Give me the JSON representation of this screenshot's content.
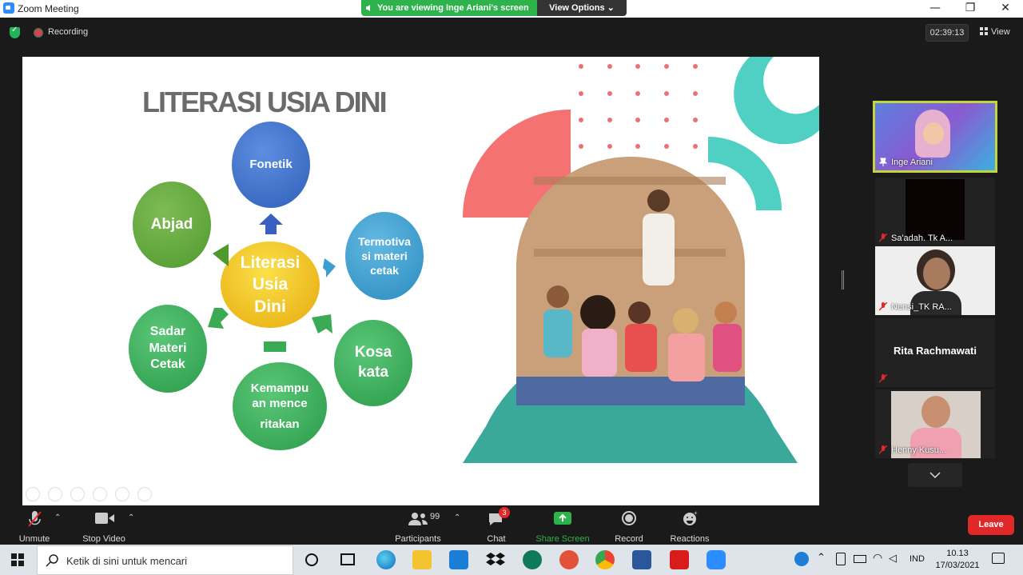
{
  "window": {
    "title": "Zoom Meeting",
    "minimize": "—",
    "maximize": "❐",
    "close": "✕"
  },
  "share_banner": {
    "viewing_text": "You are viewing Inge Ariani's screen",
    "view_options_label": "View Options ⌄"
  },
  "top_bar": {
    "recording_label": "Recording",
    "timer": "02:39:13",
    "view_label": "View"
  },
  "slide": {
    "title": "LITERASI USIA DINI",
    "center_bubble": [
      "Literasi",
      "Usia",
      "Dini"
    ],
    "bubbles": {
      "fonetik": "Fonetik",
      "termotivasi": [
        "Termotiva",
        "si materi",
        "cetak"
      ],
      "kosa_kata": [
        "Kosa",
        "kata"
      ],
      "kemampuan": [
        "Kemampu",
        "an mence",
        "ritakan"
      ],
      "sadar": [
        "Sadar",
        "Materi",
        "Cetak"
      ],
      "abjad": "Abjad"
    },
    "colors": {
      "blue": "#3a6fd0",
      "teal_blue": "#3a9fcf",
      "green": "#3aaa55",
      "yellow": "#f2c21b",
      "coral": "#f47272",
      "teal": "#4fd0c3"
    }
  },
  "participants": [
    {
      "name": "Inge Ariani",
      "active_speaker": true
    },
    {
      "name": "Sa'adah. Tk A..."
    },
    {
      "name": "Nensi_TK RA..."
    },
    {
      "name": "Rita Rachmawati",
      "no_video": true
    },
    {
      "name": "Henny Kusu..."
    }
  ],
  "toolbar": {
    "unmute": "Unmute",
    "stop_video": "Stop Video",
    "participants": "Participants",
    "participants_count": "99",
    "chat": "Chat",
    "chat_badge": "3",
    "share_screen": "Share Screen",
    "record": "Record",
    "reactions": "Reactions",
    "leave": "Leave"
  },
  "taskbar": {
    "search_placeholder": "Ketik di sini untuk mencari",
    "language": "IND",
    "time": "10.13",
    "date": "17/03/2021"
  }
}
